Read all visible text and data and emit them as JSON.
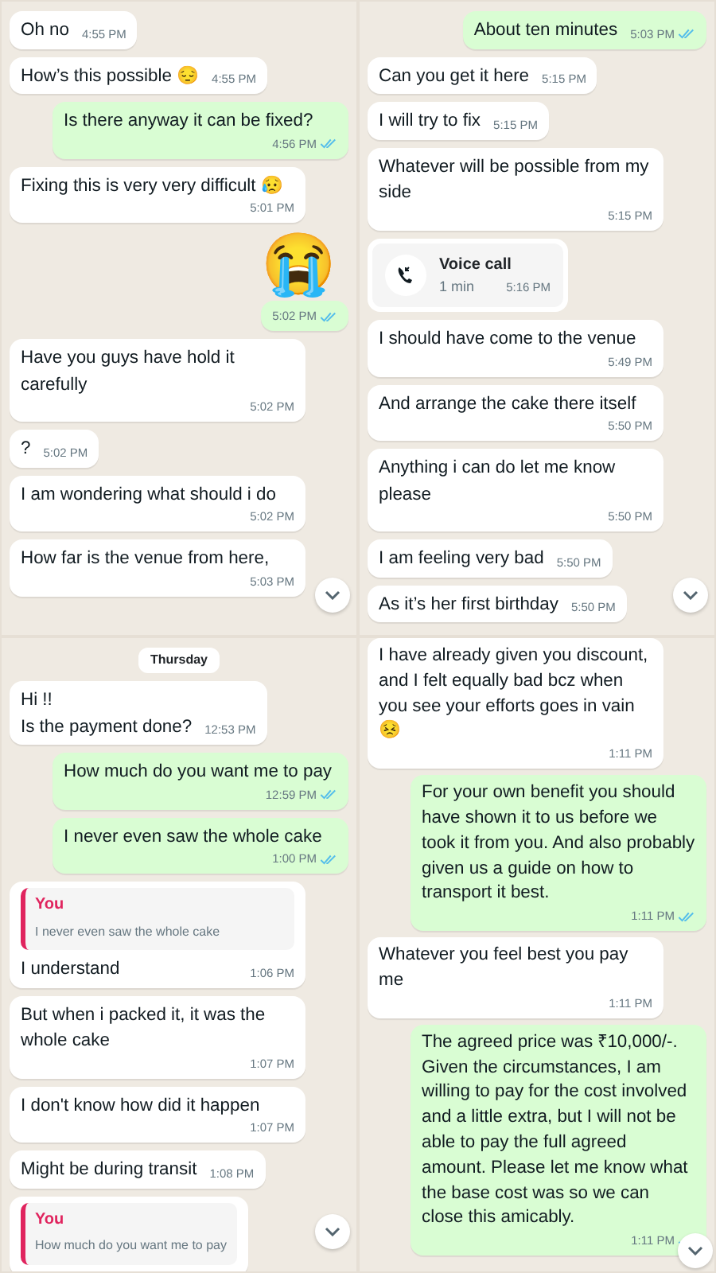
{
  "panels": [
    {
      "messages": [
        {
          "kind": "incoming",
          "text": "Oh no",
          "time": "4:55 PM"
        },
        {
          "kind": "incoming",
          "text": "How’s this possible 😔",
          "time": "4:55 PM"
        },
        {
          "kind": "outgoing",
          "text": "Is there anyway it can be fixed?",
          "time": "4:56 PM",
          "read": true
        },
        {
          "kind": "incoming",
          "text": "Fixing this is very very difficult 😥",
          "time": "5:01 PM"
        },
        {
          "kind": "sticker",
          "text": "😭",
          "time": "5:02 PM",
          "read": true
        },
        {
          "kind": "incoming",
          "text": "Have you guys have hold it carefully",
          "time": "5:02 PM"
        },
        {
          "kind": "incoming",
          "text": "?",
          "time": "5:02 PM"
        },
        {
          "kind": "incoming",
          "text": "I am wondering what should i do",
          "time": "5:02 PM"
        },
        {
          "kind": "incoming",
          "text": "How far is the venue from here,",
          "time": "5:03 PM"
        }
      ]
    },
    {
      "messages": [
        {
          "kind": "outgoing",
          "text": "About ten minutes",
          "time": "5:03 PM",
          "read": true
        },
        {
          "kind": "incoming",
          "text": "Can you get it here",
          "time": "5:15 PM"
        },
        {
          "kind": "incoming",
          "text": "I will try to fix",
          "time": "5:15 PM"
        },
        {
          "kind": "incoming",
          "text": "Whatever will be possible from my side",
          "time": "5:15 PM"
        },
        {
          "kind": "call",
          "text": "Voice call",
          "detail": "1 min",
          "time": "5:16 PM"
        },
        {
          "kind": "incoming",
          "text": "I should have come to the venue",
          "time": "5:49 PM"
        },
        {
          "kind": "incoming",
          "text": "And arrange the cake there itself",
          "time": "5:50 PM"
        },
        {
          "kind": "incoming",
          "text": "Anything i can do let me know please",
          "time": "5:50 PM"
        },
        {
          "kind": "incoming",
          "text": "I am feeling very bad",
          "time": "5:50 PM"
        },
        {
          "kind": "incoming",
          "text": "As it’s her first birthday",
          "time": "5:50 PM"
        }
      ]
    },
    {
      "messages": [
        {
          "kind": "date",
          "text": "Thursday"
        },
        {
          "kind": "incoming",
          "text": "Hi !!\nIs the payment done?",
          "time": "12:53 PM"
        },
        {
          "kind": "outgoing",
          "text": "How much do you want me to pay",
          "time": "12:59 PM",
          "read": true
        },
        {
          "kind": "outgoing",
          "text": "I never even saw the whole cake",
          "time": "1:00 PM",
          "read": true
        },
        {
          "kind": "incoming",
          "quote": {
            "author": "You",
            "text": "I never even saw the whole cake"
          },
          "text": "I understand",
          "time": "1:06 PM"
        },
        {
          "kind": "incoming",
          "text": "But when i packed it, it was the whole cake",
          "time": "1:07 PM"
        },
        {
          "kind": "incoming",
          "text": "I don't know how did it happen",
          "time": "1:07 PM"
        },
        {
          "kind": "incoming",
          "text": "Might be during transit",
          "time": "1:08 PM"
        },
        {
          "kind": "quoteonly",
          "quote": {
            "author": "You",
            "text": "How much do you want me to pay"
          }
        }
      ]
    },
    {
      "messages": [
        {
          "kind": "incoming",
          "text": "I have already given you discount, and I felt equally bad bcz when you see your efforts goes in vain 😣",
          "time": "1:11 PM"
        },
        {
          "kind": "outgoing",
          "text": "For your own benefit you should have shown it to us before we took it from you. And also probably given us a guide on how to transport it best.",
          "time": "1:11 PM",
          "read": true
        },
        {
          "kind": "incoming",
          "text": "Whatever you feel best you pay me",
          "time": "1:11 PM"
        },
        {
          "kind": "outgoing",
          "text": "The agreed price was ₹10,000/-. Given the circumstances, I am willing to pay for the cost involved and a little extra, but I will not be able to pay the full agreed amount. Please let me know what the base cost was so we can close this amicably.",
          "time": "1:11 PM",
          "read": true
        }
      ]
    }
  ]
}
